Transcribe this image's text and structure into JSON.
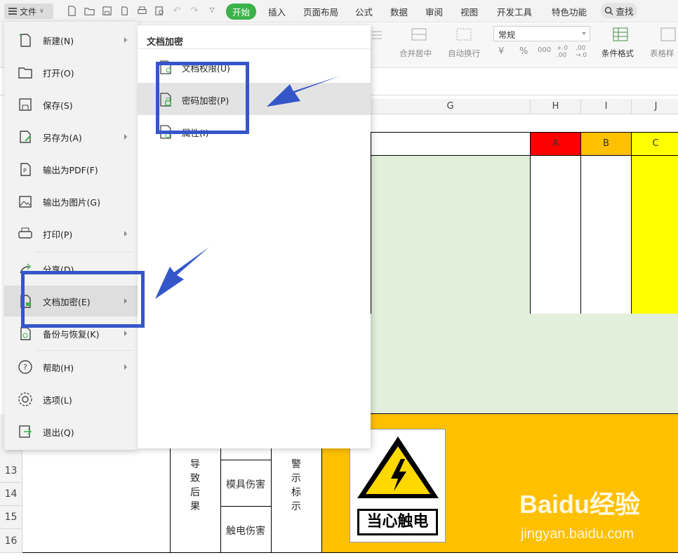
{
  "toolbar": {
    "file_label": "文件",
    "tabs": [
      "开始",
      "插入",
      "页面布局",
      "公式",
      "数据",
      "审阅",
      "视图",
      "开发工具",
      "特色功能"
    ],
    "search_label": "查找"
  },
  "ribbon": {
    "merge_center": "合并居中",
    "wrap_text": "自动换行",
    "number_format": "常规",
    "currency_symbol": "¥",
    "percent_symbol": "%",
    "thousands": "000",
    "decimal_inc": "+.0 .00",
    "decimal_dec": ".00 →.0",
    "conditional_format": "条件格式",
    "table_style": "表格样"
  },
  "sheet": {
    "columns": [
      "G",
      "H",
      "I",
      "J"
    ],
    "header_cells": [
      "A",
      "B",
      "C"
    ],
    "rows": [
      "13",
      "14",
      "15",
      "16"
    ],
    "vertical_cause": "导致后果",
    "vertical_sign": "警示标示",
    "row_mold": "模具伤害",
    "row_shock": "触电伤害",
    "sign_text": "当心触电",
    "colors": {
      "red": "#ff0000",
      "orange": "#ffc000",
      "yellow": "#ffff00",
      "green": "#e2efda",
      "amber": "#ffc000"
    }
  },
  "file_menu": {
    "items": [
      {
        "label": "新建(N)",
        "icon": "new-file-icon",
        "submenu": true
      },
      {
        "label": "打开(O)",
        "icon": "folder-open-icon",
        "submenu": false
      },
      {
        "label": "保存(S)",
        "icon": "save-icon",
        "submenu": false
      },
      {
        "label": "另存为(A)",
        "icon": "save-as-icon",
        "submenu": true
      },
      {
        "label": "输出为PDF(F)",
        "icon": "export-pdf-icon",
        "submenu": false
      },
      {
        "label": "输出为图片(G)",
        "icon": "export-image-icon",
        "submenu": false
      },
      {
        "label": "打印(P)",
        "icon": "print-icon",
        "submenu": true
      },
      {
        "label": "分享(D)",
        "icon": "share-icon",
        "submenu": false
      },
      {
        "label": "文档加密(E)",
        "icon": "document-encrypt-icon",
        "submenu": true
      },
      {
        "label": "备份与恢复(K)",
        "icon": "backup-icon",
        "submenu": true
      },
      {
        "label": "帮助(H)",
        "icon": "help-icon",
        "submenu": true
      },
      {
        "label": "选项(L)",
        "icon": "settings-icon",
        "submenu": false
      },
      {
        "label": "退出(Q)",
        "icon": "exit-icon",
        "submenu": false
      }
    ]
  },
  "submenu": {
    "title": "文档加密",
    "items": [
      {
        "label": "文档权限(U)",
        "icon": "document-permission-icon"
      },
      {
        "label": "密码加密(P)",
        "icon": "password-lock-icon"
      },
      {
        "label": "属性(I)",
        "icon": "properties-icon"
      }
    ]
  },
  "watermark": {
    "brand": "Baidu经验",
    "url": "jingyan.baidu.com"
  }
}
